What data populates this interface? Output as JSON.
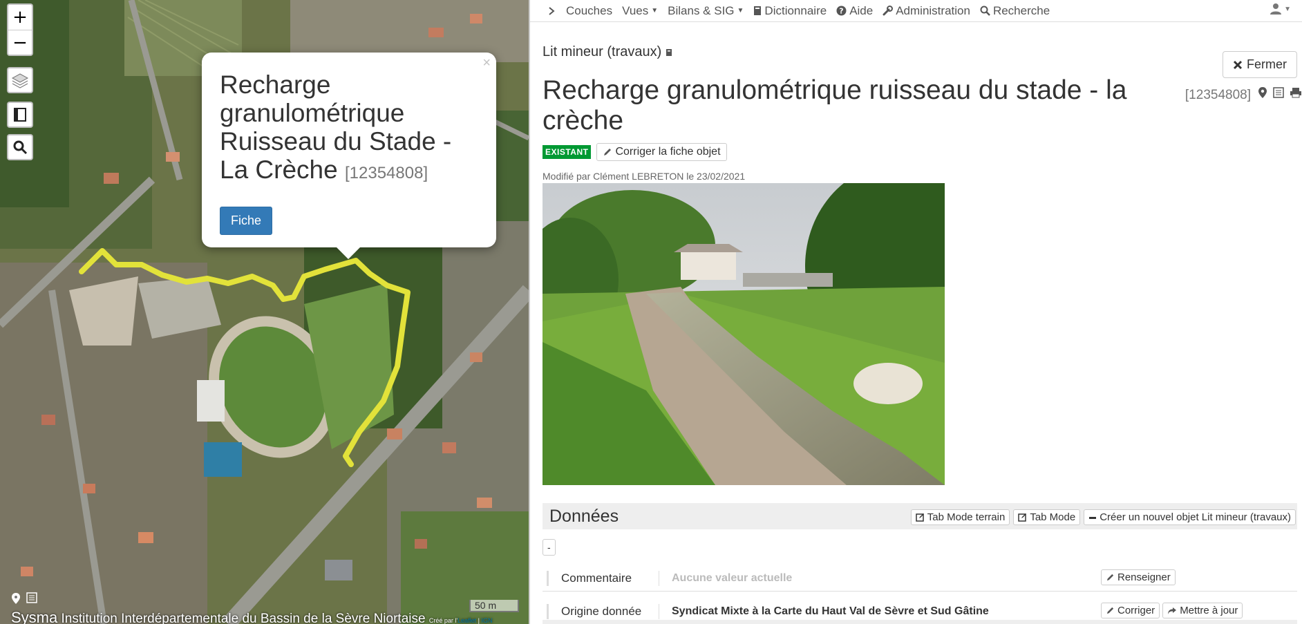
{
  "map": {
    "zoom_in": "+",
    "zoom_out": "−",
    "popup": {
      "close": "×",
      "title": "Recharge granulométrique Ruisseau du Stade - La Crèche",
      "id": "[12354808]",
      "button": "Fiche"
    },
    "scale": "50 m",
    "footer_brand": "Sysma",
    "footer_org": "Institution Interdépartementale du Bassin de la Sèvre Niortaise",
    "footer_attr_prefix": "Créé par l'",
    "footer_attr_leaflet": "Leaflet",
    "footer_attr_sep": " | ",
    "footer_attr_ign": "IGN",
    "route_color": "#e2e23a"
  },
  "navbar": {
    "items": [
      {
        "label": "Couches",
        "icon": "chevron-right-icon"
      },
      {
        "label": "Vues",
        "icon": "caret-down-icon"
      },
      {
        "label": "Bilans & SIG",
        "icon": "caret-down-icon"
      },
      {
        "label": "Dictionnaire",
        "icon": "book-icon"
      },
      {
        "label": "Aide",
        "icon": "question-circle-icon"
      },
      {
        "label": "Administration",
        "icon": "wrench-icon"
      },
      {
        "label": "Recherche",
        "icon": "search-icon"
      }
    ]
  },
  "panel": {
    "close_label": "Fermer",
    "subtype": "Lit mineur (travaux)",
    "title": "Recharge granulométrique ruisseau du stade - la crèche",
    "title_id": "[12354808]",
    "status_badge": "EXISTANT",
    "status_color": "#009933",
    "correct_button": "Corriger la fiche objet",
    "modified": "Modifié par Clément LEBRETON le 23/02/2021",
    "section_title": "Données",
    "tools": {
      "tab_terrain": "Tab Mode terrain",
      "tab_mode": "Tab Mode",
      "create": "Créer un nouvel objet Lit mineur (travaux)"
    },
    "toggle": "-",
    "rows": [
      {
        "label": "Commentaire",
        "value": "Aucune valeur actuelle",
        "actions": [
          "Renseigner"
        ]
      },
      {
        "label": "Origine donnée",
        "value": "Syndicat Mixte à la Carte du Haut Val de Sèvre et Sud Gâtine",
        "actions": [
          "Corriger",
          "Mettre à jour"
        ]
      }
    ]
  }
}
